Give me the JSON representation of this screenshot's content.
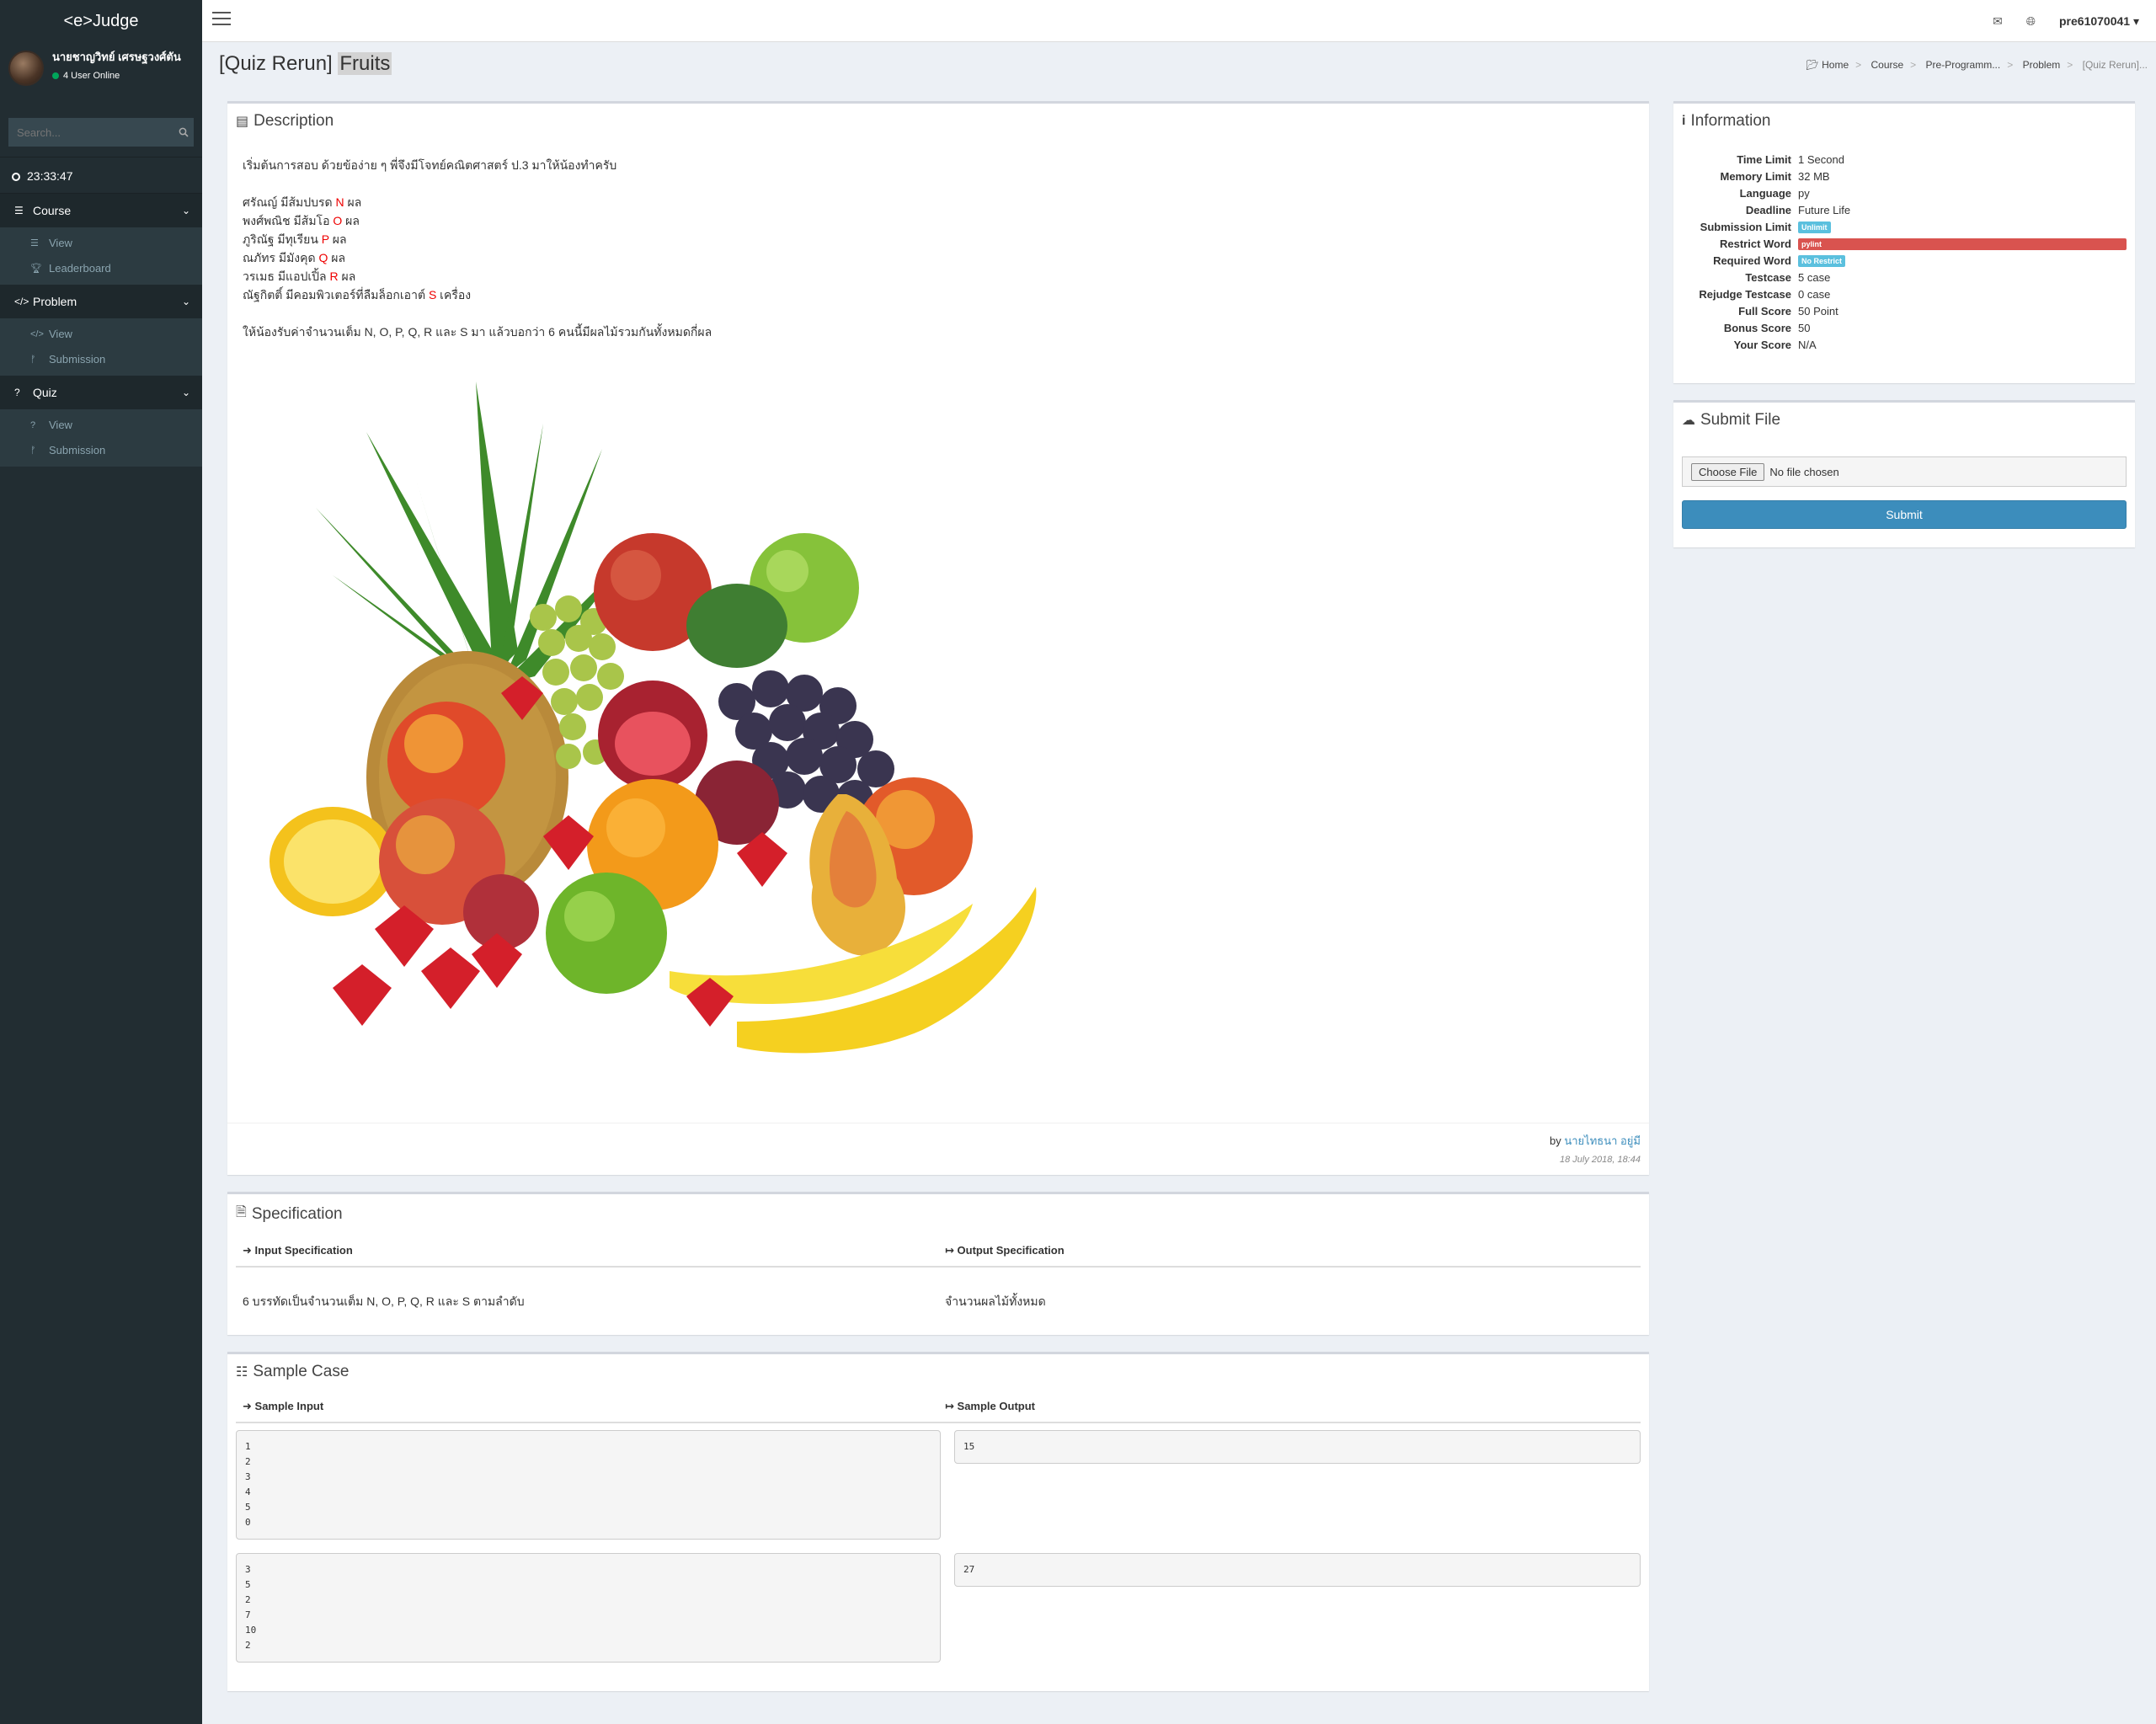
{
  "sidebar": {
    "logo": "<e>Judge",
    "user_name": "นายชาญวิทย์ เศรษฐวงศ์ตัน",
    "user_status": "4 User Online",
    "search_placeholder": "Search...",
    "clock": "23:33:47",
    "menus": [
      {
        "label": "Course",
        "items": [
          {
            "label": "View"
          },
          {
            "label": "Leaderboard"
          }
        ]
      },
      {
        "label": "Problem",
        "items": [
          {
            "label": "View"
          },
          {
            "label": "Submission"
          }
        ]
      },
      {
        "label": "Quiz",
        "items": [
          {
            "label": "View"
          },
          {
            "label": "Submission"
          }
        ]
      }
    ]
  },
  "topbar": {
    "username": "pre61070041"
  },
  "header": {
    "title_prefix": "[Quiz Rerun]",
    "title_highlight": "Fruits",
    "breadcrumb": [
      "Home",
      "Course",
      "Pre-Programm...",
      "Problem",
      "[Quiz Rerun]..."
    ]
  },
  "description": {
    "title": "Description",
    "intro": "เริ่มต้นการสอบ ด้วยข้อง่าย ๆ พี่จึงมีโจทย์คณิตศาสตร์ ป.3 มาให้น้องทำครับ",
    "lines": [
      {
        "text": "ศรัณญ์ มีส้มปบรด",
        "var": "N",
        "unit": "ผล"
      },
      {
        "text": "พงศ์พณิช มีส้มโอ",
        "var": "O",
        "unit": "ผล"
      },
      {
        "text": "ภูริณัฐ มีทุเรียน",
        "var": "P",
        "unit": "ผล"
      },
      {
        "text": "ณภัทร มีมังคุด",
        "var": "Q",
        "unit": "ผล"
      },
      {
        "text": "วรเมธ มีแอปเปิ้ล",
        "var": "R",
        "unit": "ผล"
      },
      {
        "text": "ณัฐกิตติ์ มีคอมพิวเตอร์ที่ลืมล็อกเอาต์",
        "var": "S",
        "unit": "เครื่อง"
      }
    ],
    "question": "ให้น้องรับค่าจำนวนเต็ม N, O, P, Q, R และ S มา แล้วบอกว่า 6 คนนี้มีผลไม้รวมกันทั้งหมดกี่ผล",
    "by_label": "by",
    "author": "นายไทธนา อยู่มี",
    "date": "18 July 2018, 18:44"
  },
  "specification": {
    "title": "Specification",
    "input_label": "Input Specification",
    "output_label": "Output Specification",
    "input_text": "6 บรรทัดเป็นจำนวนเต็ม N, O, P, Q, R และ S ตามลำดับ",
    "output_text": "จำนวนผลไม้ทั้งหมด"
  },
  "samples": {
    "title": "Sample Case",
    "input_label": "Sample Input",
    "output_label": "Sample Output",
    "cases": [
      {
        "input": "1\n2\n3\n4\n5\n0",
        "output": "15"
      },
      {
        "input": "3\n5\n2\n7\n10\n2",
        "output": "27"
      }
    ]
  },
  "information": {
    "title": "Information",
    "rows": [
      {
        "label": "Time Limit",
        "value": "1 Second"
      },
      {
        "label": "Memory Limit",
        "value": "32 MB"
      },
      {
        "label": "Language",
        "value": "py"
      },
      {
        "label": "Deadline",
        "value": "Future Life"
      },
      {
        "label": "Submission Limit",
        "badge": "Unlimit"
      },
      {
        "label": "Restrict Word",
        "badge": "pylint"
      },
      {
        "label": "Required Word",
        "badge": "No Restrict"
      },
      {
        "label": "Testcase",
        "value": "5 case"
      },
      {
        "label": "Rejudge Testcase",
        "value": "0 case"
      },
      {
        "label": "Full Score",
        "value": "50 Point"
      },
      {
        "label": "Bonus Score",
        "value": "50"
      },
      {
        "label": "Your Score",
        "value": "N/A"
      }
    ]
  },
  "submit_file": {
    "title": "Submit File",
    "choose_label": "Choose File",
    "no_file": "No file chosen",
    "submit_label": "Submit"
  },
  "colors": {
    "sidebar_bg": "#222d32",
    "accent": "#3c8dbc",
    "danger": "#d9534f",
    "info": "#5bc0de"
  }
}
